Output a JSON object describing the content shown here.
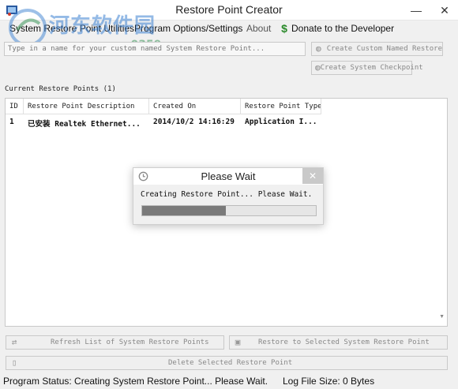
{
  "window": {
    "title": "Restore Point Creator",
    "minimize_glyph": "—",
    "close_glyph": "✕"
  },
  "watermark": {
    "line1": "河东软件园",
    "line2": "www.pc0359.cn"
  },
  "menu": {
    "items": [
      "System Restore Point Utilities",
      "Program Options/Settings",
      "About",
      "Donate to the Developer"
    ]
  },
  "create": {
    "input_placeholder": "Type in a name for your custom named System Restore Point...",
    "custom_button": "Create Custom Named Restore",
    "checkpoint_button": "Create System Checkpoint"
  },
  "list": {
    "label": "Current Restore Points (1)",
    "columns": [
      "ID",
      "Restore Point Description",
      "Created On",
      "Restore Point Type"
    ],
    "rows": [
      [
        "1",
        "已安装 Realtek Ethernet...",
        "2014/10/2 14:16:29",
        "Application I..."
      ]
    ]
  },
  "actions": {
    "refresh": "Refresh List of System Restore Points",
    "restore": "Restore to Selected System Restore Point",
    "delete": "Delete Selected Restore Point"
  },
  "status": {
    "program_status_label": "Program Status:",
    "program_status_value": "Creating System Restore Point... Please Wait.",
    "log_label": "Log File Size:",
    "log_value": "0 Bytes"
  },
  "dialog": {
    "title": "Please Wait",
    "close_glyph": "✕",
    "message": "Creating Restore Point... Please Wait.",
    "progress": 0.48
  },
  "colors": {
    "progress_fill": "#7a7a7a",
    "donate_icon": "#2a8a2a"
  },
  "icons": [
    "app-icon",
    "shield-icon",
    "refresh-icon",
    "restore-icon",
    "trash-icon",
    "dollar-icon",
    "clock-icon"
  ]
}
